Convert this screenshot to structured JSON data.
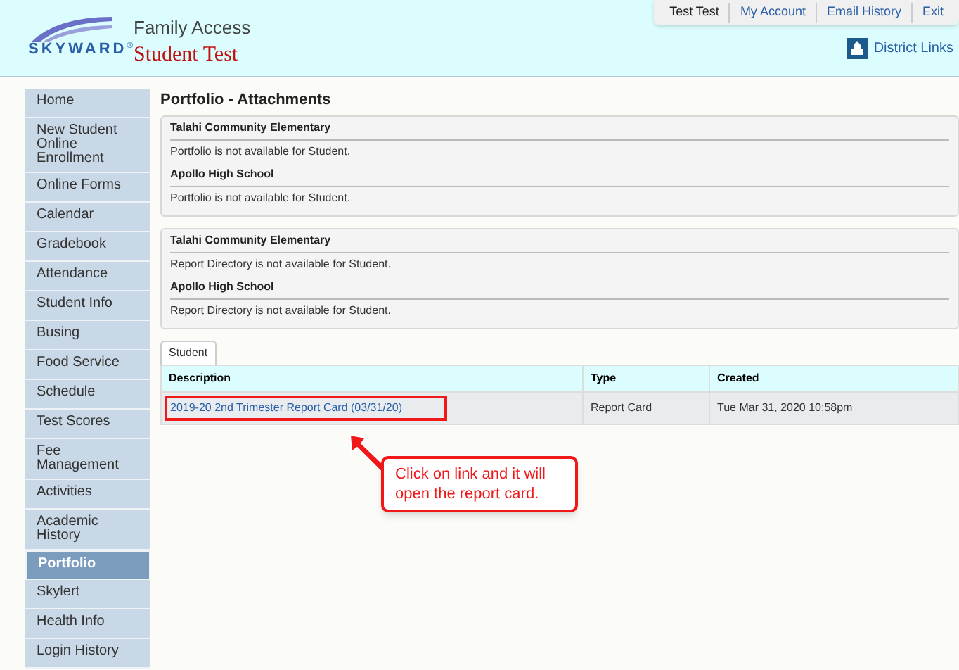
{
  "header": {
    "logo_text": "SKYWARD",
    "logo_mark": "®",
    "app_name": "Family Access",
    "student_name": "Student Test",
    "top_links": [
      "Test Test",
      "My Account",
      "Email History",
      "Exit"
    ],
    "district_links": "District Links"
  },
  "sidebar": {
    "items": [
      {
        "label": "Home",
        "selected": false
      },
      {
        "label": "New Student Online Enrollment",
        "selected": false
      },
      {
        "label": "Online Forms",
        "selected": false
      },
      {
        "label": "Calendar",
        "selected": false
      },
      {
        "label": "Gradebook",
        "selected": false
      },
      {
        "label": "Attendance",
        "selected": false
      },
      {
        "label": "Student Info",
        "selected": false
      },
      {
        "label": "Busing",
        "selected": false
      },
      {
        "label": "Food Service",
        "selected": false
      },
      {
        "label": "Schedule",
        "selected": false
      },
      {
        "label": "Test Scores",
        "selected": false
      },
      {
        "label": "Fee Management",
        "selected": false
      },
      {
        "label": "Activities",
        "selected": false
      },
      {
        "label": "Academic History",
        "selected": false
      },
      {
        "label": "Portfolio",
        "selected": true
      },
      {
        "label": "Skylert",
        "selected": false
      },
      {
        "label": "Health Info",
        "selected": false
      },
      {
        "label": "Login History",
        "selected": false
      }
    ]
  },
  "page_title": "Portfolio - Attachments",
  "panels": [
    {
      "schools": [
        {
          "name": "Talahi Community Elementary",
          "message": "Portfolio is not available for Student."
        },
        {
          "name": "Apollo High School",
          "message": "Portfolio is not available for Student."
        }
      ]
    },
    {
      "schools": [
        {
          "name": "Talahi Community Elementary",
          "message": "Report Directory is not available for Student."
        },
        {
          "name": "Apollo High School",
          "message": "Report Directory is not available for Student."
        }
      ]
    }
  ],
  "tabs": [
    {
      "label": "Student",
      "selected": true
    }
  ],
  "table": {
    "columns": [
      "Description",
      "Type",
      "Created"
    ],
    "rows": [
      {
        "description": "2019-20 2nd Trimester Report Card (03/31/20)",
        "type": "Report Card",
        "created": "Tue Mar 31, 2020 10:58pm"
      }
    ]
  },
  "callout": {
    "text": "Click on link and it will open the report card."
  }
}
